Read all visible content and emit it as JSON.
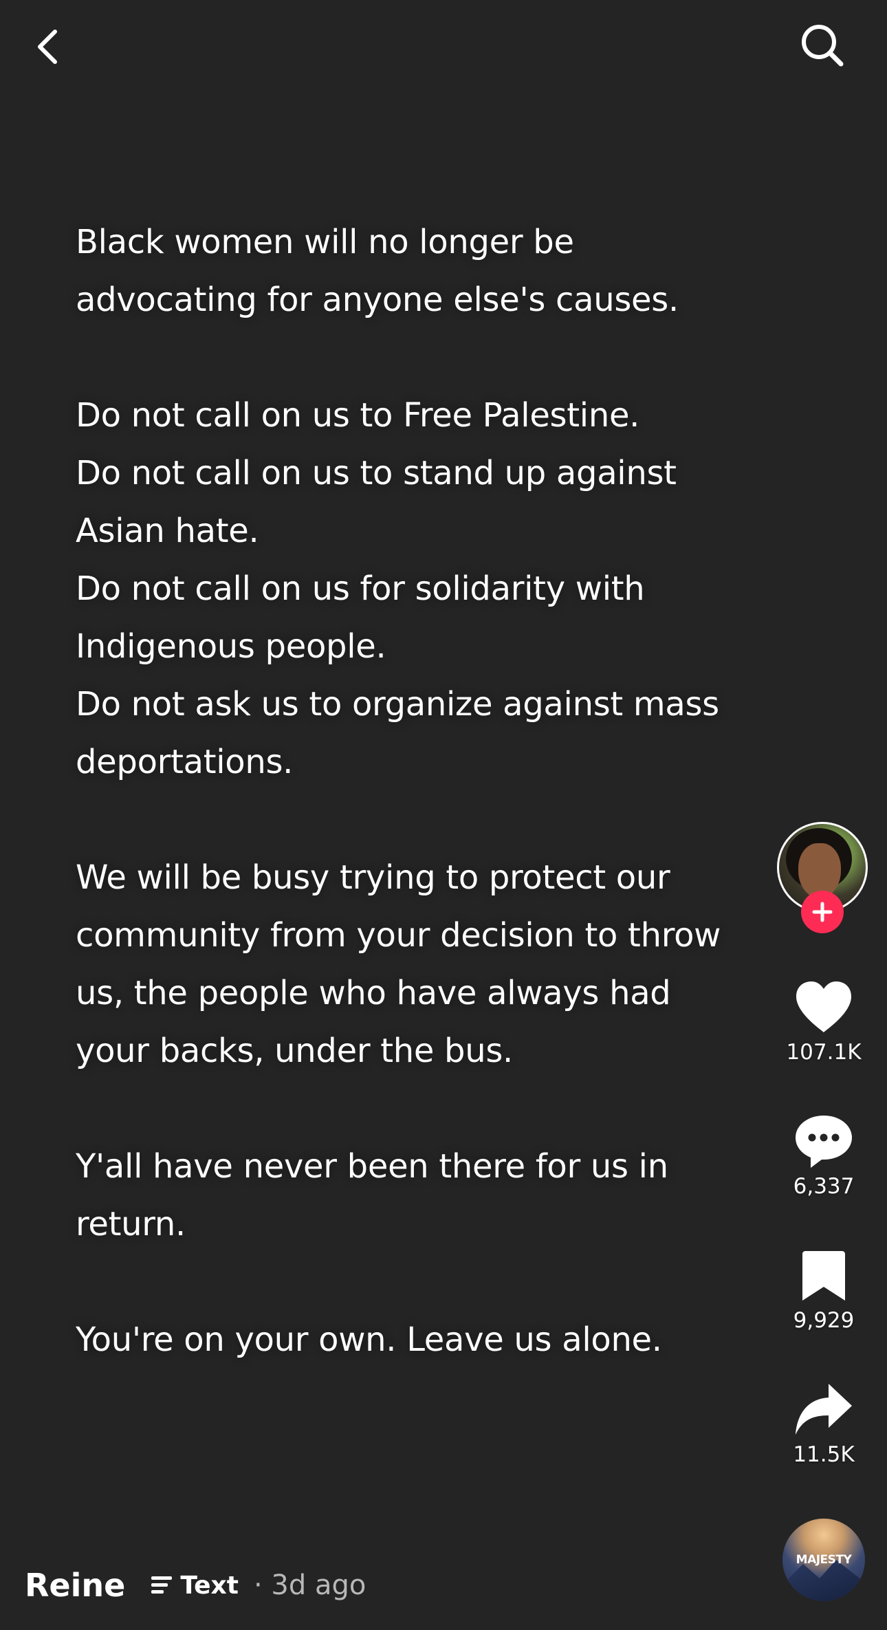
{
  "header": {
    "back_icon": "chevron-left-icon",
    "search_icon": "search-icon"
  },
  "post": {
    "paragraphs": [
      [
        "Black women will no longer be",
        "advocating for anyone else's causes."
      ],
      [
        "Do not call on us to Free Palestine.",
        "Do not call on us to stand up against",
        "Asian hate.",
        "Do not call on us for solidarity with",
        "Indigenous people.",
        "Do not ask us to organize against mass",
        "deportations."
      ],
      [
        "We will be busy trying to protect our",
        "community from your decision to throw",
        "us, the people who have always had",
        "your backs, under the bus."
      ],
      [
        "Y'all have never been there for us in",
        "return."
      ],
      [
        "You're on your own. Leave us alone."
      ]
    ]
  },
  "actions": {
    "likes": "107.1K",
    "comments": "6,337",
    "saves": "9,929",
    "shares": "11.5K"
  },
  "music": {
    "label": "MAJESTY"
  },
  "footer": {
    "author": "Reine",
    "type_label": "Text",
    "time": "· 3d ago"
  },
  "colors": {
    "background": "#242424",
    "follow_accent": "#fe2c55",
    "text": "#ffffff",
    "muted": "#b8b8b8"
  }
}
